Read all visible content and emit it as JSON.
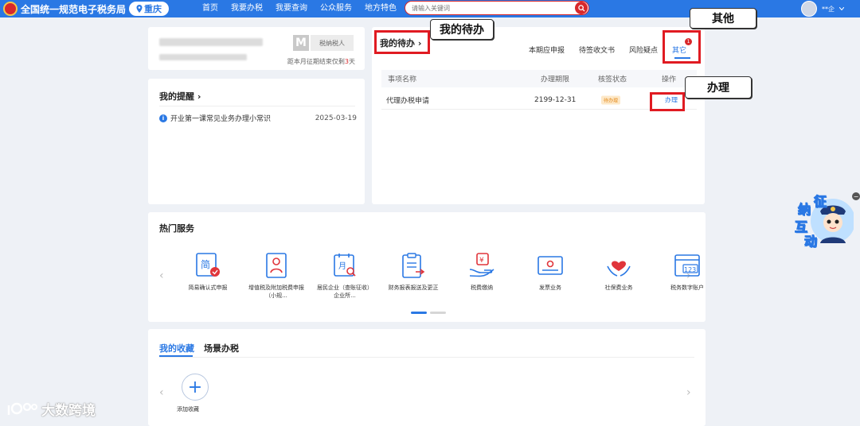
{
  "header": {
    "site_title": "全国统一规范电子税务局",
    "region": "重庆",
    "nav": [
      "首页",
      "我要办税",
      "我要查询",
      "公众服务",
      "地方特色"
    ],
    "search_placeholder": "请输入关键词",
    "user_name": "**企"
  },
  "profile": {
    "m_badge": "M",
    "tax_type": "税纳税人",
    "deadline_prefix": "距本月征期结束仅剩",
    "deadline_days": "3",
    "deadline_suffix": "天"
  },
  "reminders": {
    "title": "我的提醒",
    "items": [
      {
        "text": "开业第一课常见业务办理小常识",
        "date": "2025-03-19"
      }
    ]
  },
  "todo": {
    "title": "我的待办",
    "tabs": [
      "本期应申报",
      "待签收文书",
      "风险疑点",
      "其它"
    ],
    "active_tab": "其它",
    "badge_count": "1",
    "columns": [
      "事项名称",
      "办理期限",
      "核签状态",
      "操作"
    ],
    "rows": [
      {
        "name": "代理办税申请",
        "deadline": "2199-12-31",
        "status": "待办理",
        "action": "办理"
      }
    ]
  },
  "annotations": {
    "todo_label": "我的待办",
    "other_label": "其他",
    "handle_label": "办理"
  },
  "hot_services": {
    "title": "热门服务",
    "items": [
      {
        "label": "简易确认式申报",
        "icon": "simple-declare-icon"
      },
      {
        "label": "增值税及附加税费申报（小规...",
        "icon": "vat-declare-icon"
      },
      {
        "label": "居民企业（查账征收）企业所...",
        "icon": "enterprise-income-icon"
      },
      {
        "label": "财务报表报送及更正",
        "icon": "financial-report-icon"
      },
      {
        "label": "税费缴纳",
        "icon": "tax-payment-icon"
      },
      {
        "label": "发票业务",
        "icon": "invoice-icon"
      },
      {
        "label": "社保费业务",
        "icon": "social-security-icon"
      },
      {
        "label": "税务数字账户",
        "icon": "digital-account-icon"
      }
    ]
  },
  "favorites": {
    "tabs": [
      "我的收藏",
      "场景办税"
    ],
    "active_tab": "我的收藏",
    "add_label": "添加收藏"
  },
  "widget": {
    "chars": [
      "征",
      "纳",
      "互",
      "动"
    ]
  },
  "watermark": "大数跨境",
  "colors": {
    "brand_blue": "#2a78e4",
    "alert_red": "#e01b22",
    "background": "#eef1f6"
  }
}
